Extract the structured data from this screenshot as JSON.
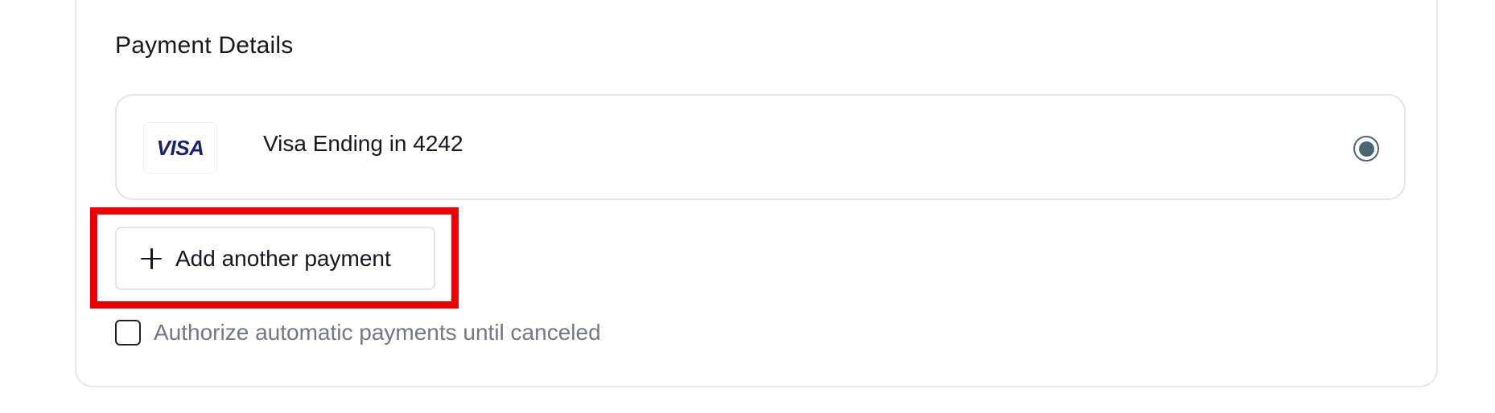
{
  "payment_details": {
    "title": "Payment Details",
    "saved_method": {
      "brand_logo_text": "VISA",
      "label": "Visa Ending in 4242",
      "selected": true
    },
    "add_payment_button": {
      "icon": "plus-icon",
      "label": "Add another payment"
    },
    "autopay_checkbox": {
      "label": "Authorize automatic payments until canceled",
      "checked": false
    }
  },
  "annotation": {
    "highlight_color": "#ee0000"
  },
  "colors": {
    "visa_blue": "#1a1f71",
    "radio_accent": "#4d6570",
    "muted_text": "#74777f"
  }
}
